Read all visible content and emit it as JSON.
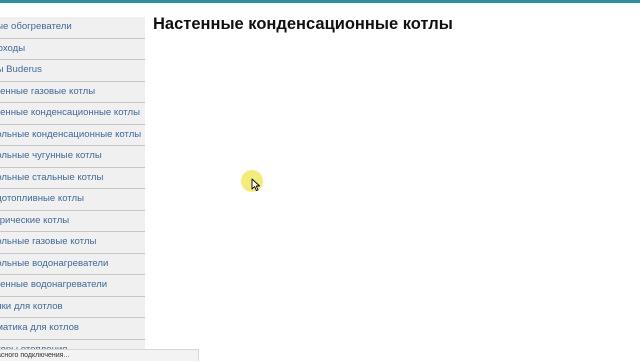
{
  "sidebar": {
    "items": [
      {
        "label": "вые обогреватели"
      },
      {
        "label": "моходы"
      },
      {
        "label": "лы Buderus"
      },
      {
        "label": "стенные газовые котлы"
      },
      {
        "label": "стенные конденсационные котлы"
      },
      {
        "label": "польные конденсационные котлы"
      },
      {
        "label": "польные чугунные котлы"
      },
      {
        "label": "польные стальные котлы"
      },
      {
        "label": "рдотопливные котлы"
      },
      {
        "label": "ктрические котлы"
      },
      {
        "label": "польные газовые котлы"
      },
      {
        "label": "польные водонагреватели"
      },
      {
        "label": "стенные водонагреватели"
      },
      {
        "label": "елки для котлов"
      },
      {
        "label": "оматика для котлов"
      },
      {
        "label": "яторы отопления"
      }
    ]
  },
  "main": {
    "title": "Настенные конденсационные котлы"
  },
  "status": {
    "text": "асного подключения..."
  },
  "colors": {
    "accent": "#2f8fa0",
    "link": "#3f6a9a",
    "cursor_highlight": "#f3ea6a"
  },
  "icons": {
    "cursor": "mouse-pointer-icon"
  }
}
